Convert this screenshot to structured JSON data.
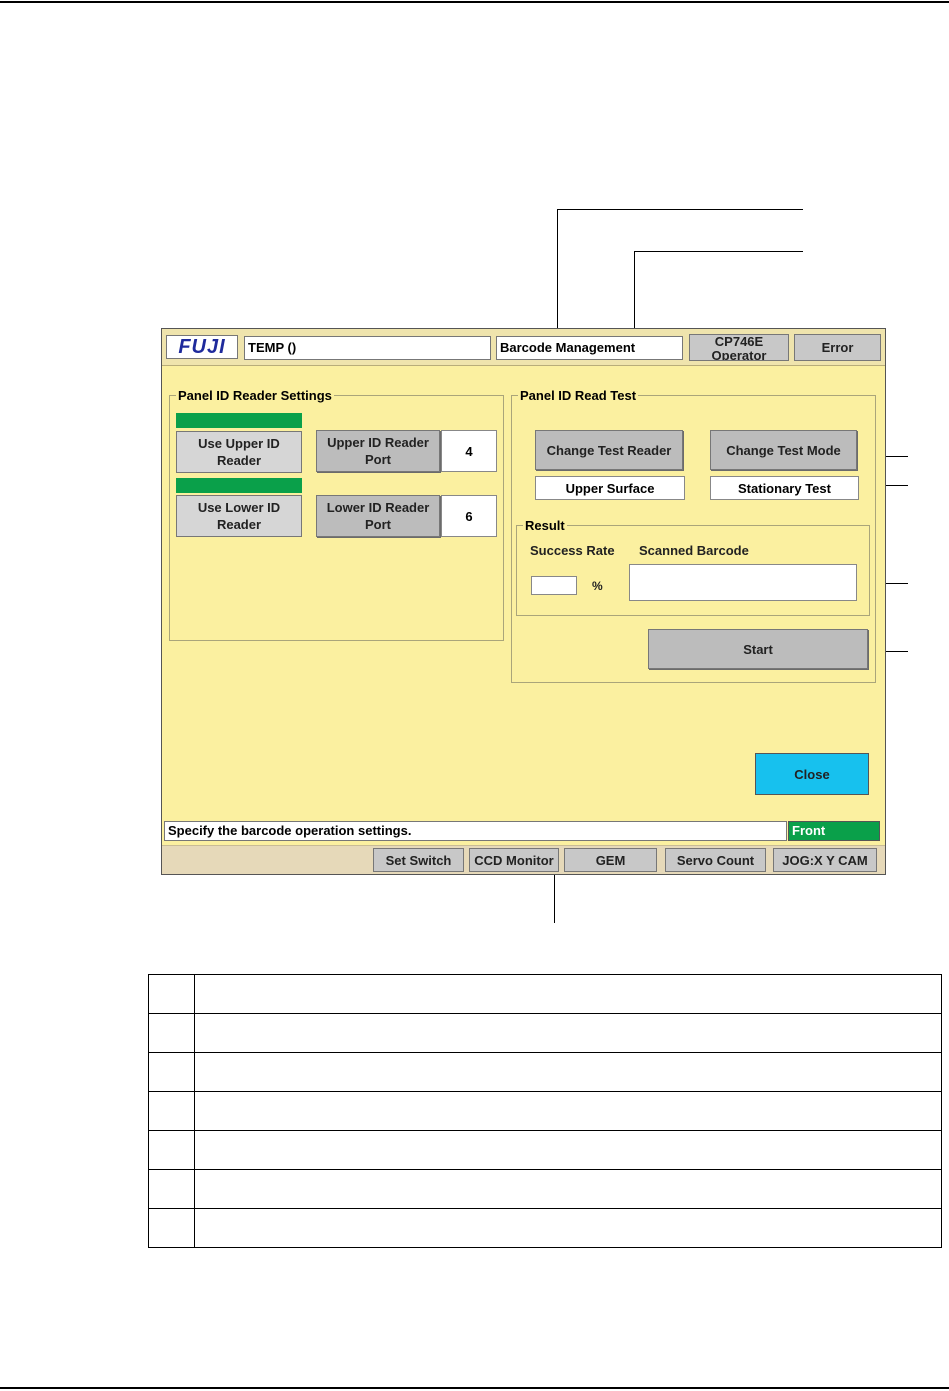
{
  "window": {
    "logo": "FUJI",
    "machine_name": "TEMP  ()",
    "screen_title": "Barcode Management",
    "operator_line1": "CP746E",
    "operator_line2": "Operator",
    "error_label": "Error"
  },
  "reader_settings": {
    "title": "Panel ID Reader Settings",
    "upper": {
      "label_line1": "Use Upper ID",
      "label_line2": "Reader",
      "port_line1": "Upper ID Reader",
      "port_line2": "Port",
      "port_value": "4"
    },
    "lower": {
      "label_line1": "Use Lower ID",
      "label_line2": "Reader",
      "port_line1": "Lower ID Reader",
      "port_line2": "Port",
      "port_value": "6"
    }
  },
  "read_test": {
    "title": "Panel ID Read Test",
    "change_reader_label": "Change Test Reader",
    "reader_value": "Upper Surface",
    "change_mode_label": "Change Test Mode",
    "mode_value": "Stationary Test",
    "result": {
      "title": "Result",
      "success_rate_label": "Success Rate",
      "success_rate_value": "",
      "percent_unit": "%",
      "scanned_barcode_label": "Scanned Barcode",
      "scanned_barcode_value": ""
    },
    "start_label": "Start"
  },
  "close_label": "Close",
  "status": {
    "message": "Specify the barcode operation settings.",
    "side": "Front"
  },
  "bottom_buttons": [
    "Set Switch",
    "CCD Monitor",
    "GEM",
    "Servo Count",
    "JOG:X Y CAM"
  ],
  "colors": {
    "panel_bg": "#fbf0a0",
    "active_green": "#0aa04a",
    "close_cyan": "#17c1ee",
    "logo_blue": "#1e2a9c"
  }
}
